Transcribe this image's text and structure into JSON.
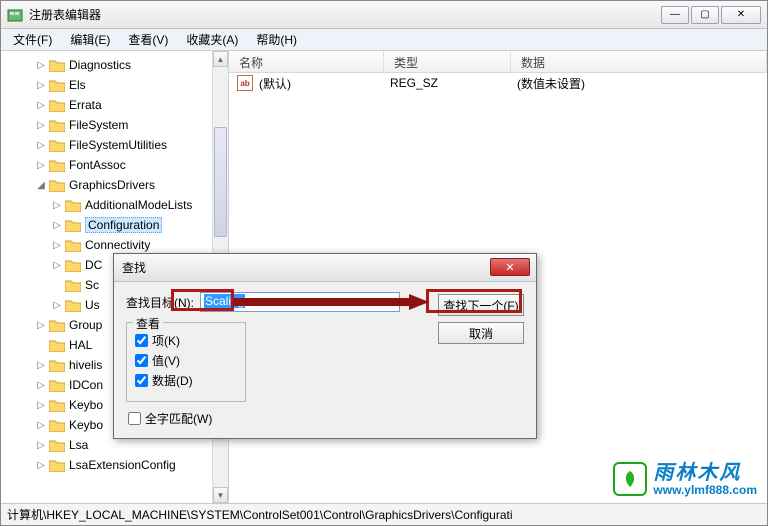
{
  "window": {
    "title": "注册表编辑器",
    "controls": {
      "min": "—",
      "max": "▢",
      "close": "✕"
    }
  },
  "menu": {
    "file": "文件(F)",
    "edit": "编辑(E)",
    "view": "查看(V)",
    "favorites": "收藏夹(A)",
    "help": "帮助(H)"
  },
  "tree": [
    {
      "indent": 2,
      "toggle": "▷",
      "label": "Diagnostics"
    },
    {
      "indent": 2,
      "toggle": "▷",
      "label": "Els"
    },
    {
      "indent": 2,
      "toggle": "▷",
      "label": "Errata"
    },
    {
      "indent": 2,
      "toggle": "▷",
      "label": "FileSystem"
    },
    {
      "indent": 2,
      "toggle": "▷",
      "label": "FileSystemUtilities"
    },
    {
      "indent": 2,
      "toggle": "▷",
      "label": "FontAssoc"
    },
    {
      "indent": 2,
      "toggle": "◢",
      "label": "GraphicsDrivers"
    },
    {
      "indent": 3,
      "toggle": "▷",
      "label": "AdditionalModeLists"
    },
    {
      "indent": 3,
      "toggle": "▷",
      "label": "Configuration",
      "selected": true
    },
    {
      "indent": 3,
      "toggle": "▷",
      "label": "Connectivity"
    },
    {
      "indent": 3,
      "toggle": "▷",
      "label": "DC"
    },
    {
      "indent": 3,
      "toggle": "",
      "label": "Sc"
    },
    {
      "indent": 3,
      "toggle": "▷",
      "label": "Us"
    },
    {
      "indent": 2,
      "toggle": "▷",
      "label": "Group"
    },
    {
      "indent": 2,
      "toggle": "",
      "label": "HAL"
    },
    {
      "indent": 2,
      "toggle": "▷",
      "label": "hivelis"
    },
    {
      "indent": 2,
      "toggle": "▷",
      "label": "IDCon"
    },
    {
      "indent": 2,
      "toggle": "▷",
      "label": "Keybo"
    },
    {
      "indent": 2,
      "toggle": "▷",
      "label": "Keybo"
    },
    {
      "indent": 2,
      "toggle": "▷",
      "label": "Lsa"
    },
    {
      "indent": 2,
      "toggle": "▷",
      "label": "LsaExtensionConfig"
    }
  ],
  "list": {
    "headers": {
      "name": "名称",
      "type": "类型",
      "data": "数据"
    },
    "rows": [
      {
        "icon": "ab",
        "name": "(默认)",
        "type": "REG_SZ",
        "data": "(数值未设置)"
      }
    ]
  },
  "dialog": {
    "title": "查找",
    "target_label": "查找目标(N):",
    "target_value": "Scaling",
    "find_next": "查找下一个(F)",
    "cancel": "取消",
    "look_legend": "查看",
    "chk_keys": "项(K)",
    "chk_values": "值(V)",
    "chk_data": "数据(D)",
    "chk_whole": "全字匹配(W)"
  },
  "statusbar": {
    "path": "计算机\\HKEY_LOCAL_MACHINE\\SYSTEM\\ControlSet001\\Control\\GraphicsDrivers\\Configurati"
  },
  "watermark": {
    "brand": "雨林木风",
    "url": "www.ylmf888.com"
  }
}
